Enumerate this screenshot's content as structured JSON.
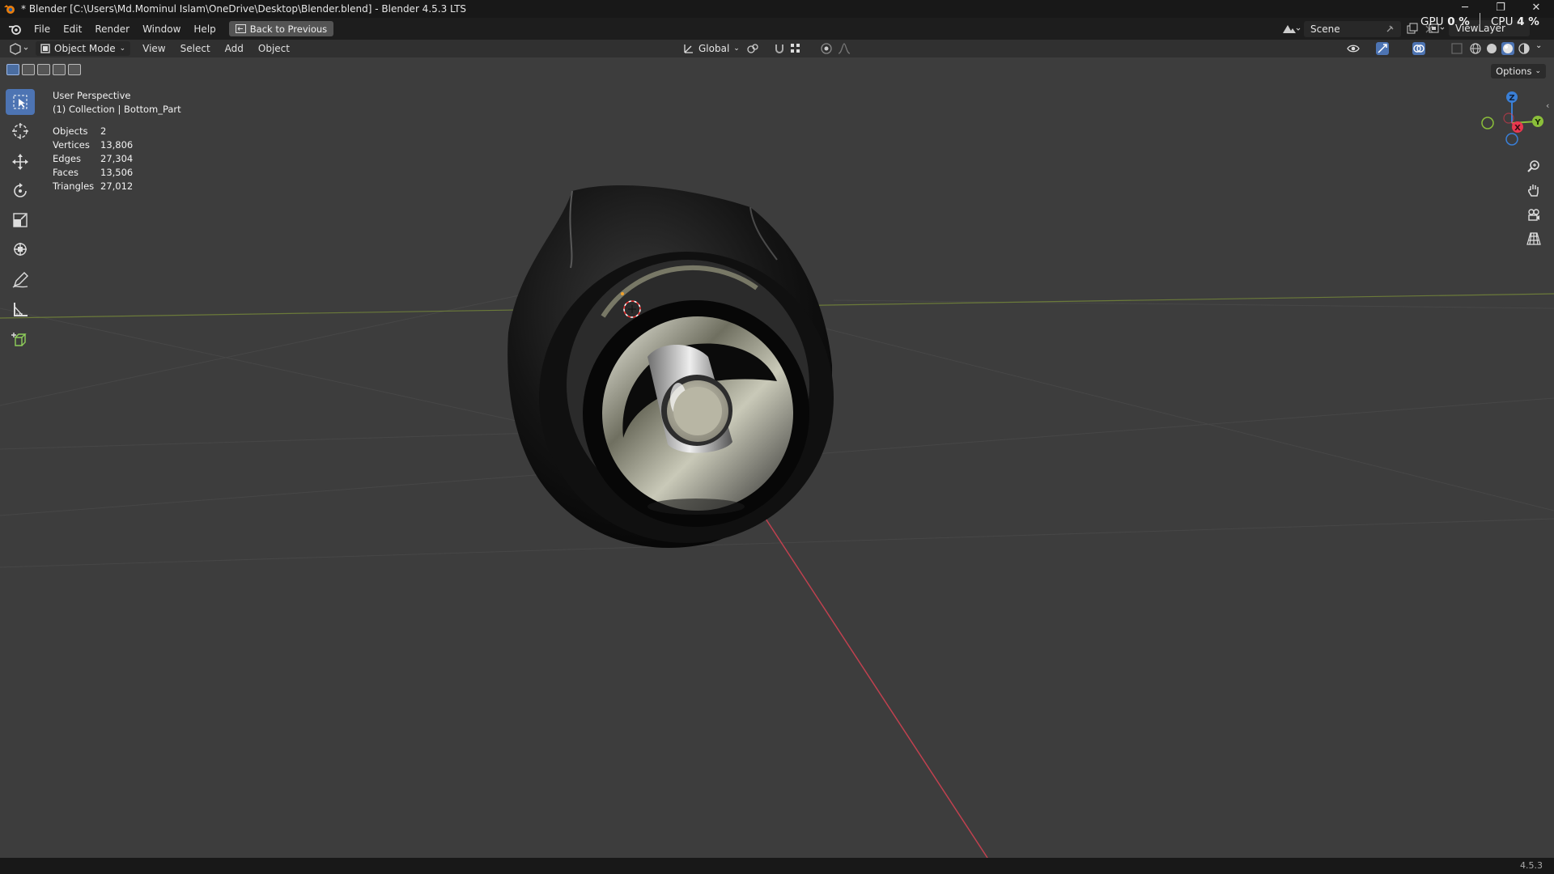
{
  "window": {
    "title": "* Blender [C:\\Users\\Md.Mominul Islam\\OneDrive\\Desktop\\Blender.blend] - Blender 4.5.3 LTS",
    "minimize": "─",
    "maximize": "❐",
    "close": "✕"
  },
  "menu": {
    "file": "File",
    "edit": "Edit",
    "render": "Render",
    "window": "Window",
    "help": "Help",
    "back_button": "Back to Previous"
  },
  "scene": {
    "name": "Scene",
    "view_layer": "ViewLayer"
  },
  "performance": {
    "gpu_label": "GPU",
    "gpu_value": "0 %",
    "cpu_label": "CPU",
    "cpu_value": "4 %"
  },
  "header": {
    "mode": "Object Mode",
    "view": "View",
    "select": "Select",
    "add": "Add",
    "object": "Object",
    "orientation": "Global",
    "options": "Options"
  },
  "viewport": {
    "perspective": "User Perspective",
    "collection": "(1) Collection | Bottom_Part",
    "stats": [
      {
        "label": "Objects",
        "value": "2"
      },
      {
        "label": "Vertices",
        "value": "13,806"
      },
      {
        "label": "Edges",
        "value": "27,304"
      },
      {
        "label": "Faces",
        "value": "13,506"
      },
      {
        "label": "Triangles",
        "value": "27,012"
      }
    ]
  },
  "gizmo": {
    "x": "X",
    "y": "Y",
    "z": "Z"
  },
  "colors": {
    "axis_x": "#e8384f",
    "axis_y": "#8bbf3a",
    "axis_z": "#3a7fd6",
    "tool_active": "#4d74b3"
  },
  "status": {
    "version": "4.5.3"
  }
}
